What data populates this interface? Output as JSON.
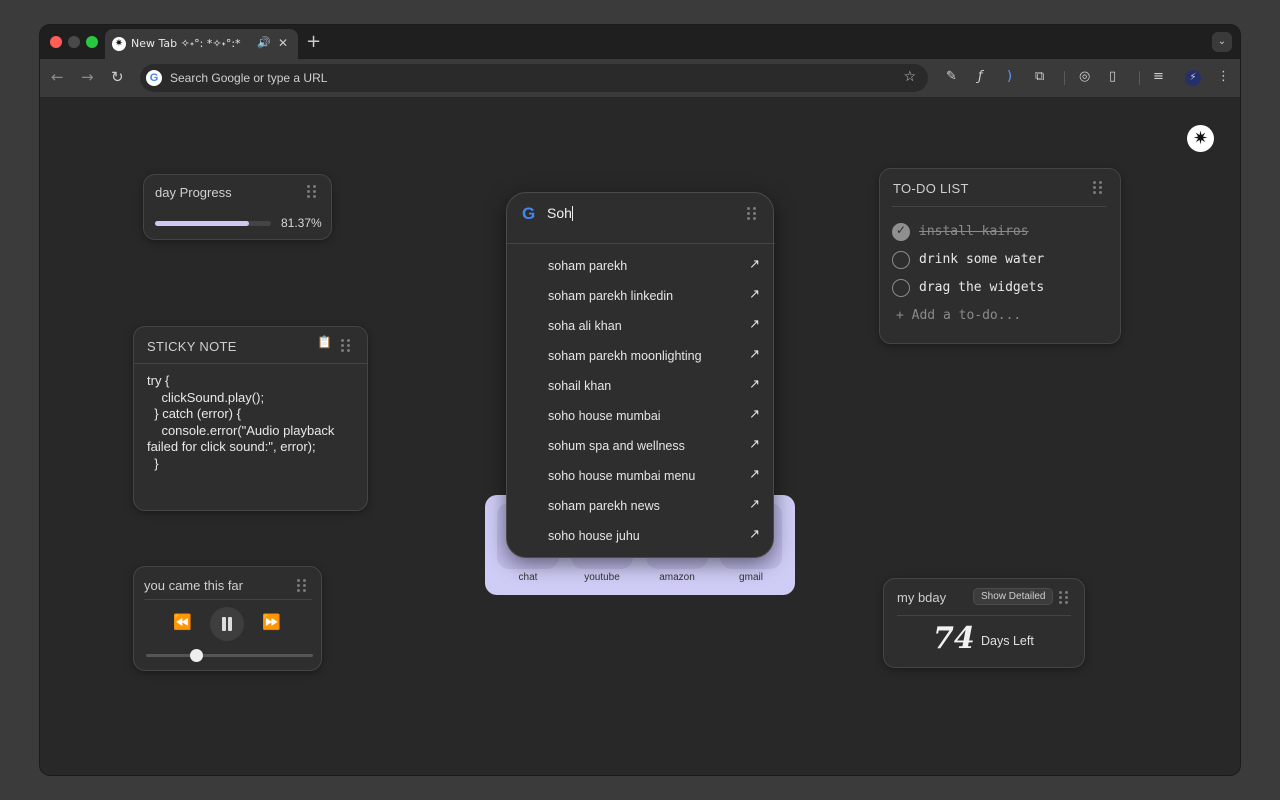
{
  "browser": {
    "tab_title": "New Tab ✧˖°: *✧˖°:*",
    "tab_favicon": "✷",
    "audio_icon": "🔊",
    "close_icon": "✕",
    "new_tab_icon": "+",
    "tab_menu_icon": "⌄",
    "omnibox_placeholder": "Search Google or type a URL",
    "g_letter": "G",
    "nav_back": "←",
    "nav_forward": "→",
    "nav_reload": "↻",
    "star_icon": "☆",
    "ext_icons": [
      "✎",
      "ƒ",
      ")",
      "⧉",
      "◎",
      "▯",
      "≡",
      "⚡",
      "⋮"
    ]
  },
  "corner_logo": "✷",
  "day_progress": {
    "title": "day Progress",
    "percent_text": "81.37%",
    "value": 0.8137
  },
  "sticky_note": {
    "title": "STICKY NOTE",
    "clipboard_icon": "📋",
    "body": "try {\n    clickSound.play();\n  } catch (error) {\n    console.error(\"Audio playback failed for click sound:\", error);\n  }"
  },
  "music": {
    "title": "you came this far",
    "rewind_icon": "⏪",
    "forward_icon": "⏩",
    "progress": 0.3
  },
  "search": {
    "g_letter": "G",
    "query": "Soh",
    "arrow_icon": "↗",
    "suggestions": [
      "soham parekh",
      "soham parekh linkedin",
      "soha ali khan",
      "soham parekh moonlighting",
      "sohail khan",
      "soho house mumbai",
      "sohum spa and wellness",
      "soho house mumbai menu",
      "soham parekh news",
      "soho house juhu"
    ]
  },
  "shortcuts": [
    {
      "label": "chat"
    },
    {
      "label": "youtube"
    },
    {
      "label": "amazon"
    },
    {
      "label": "gmail"
    }
  ],
  "todo": {
    "title": "TO-DO LIST",
    "items": [
      {
        "text": "install kairos",
        "done": true
      },
      {
        "text": "drink some water",
        "done": false
      },
      {
        "text": "drag the widgets",
        "done": false
      }
    ],
    "add_placeholder": "+  Add a to-do..."
  },
  "bday": {
    "title": "my bday",
    "button": "Show Detailed",
    "days": "74",
    "label": "Days Left"
  }
}
